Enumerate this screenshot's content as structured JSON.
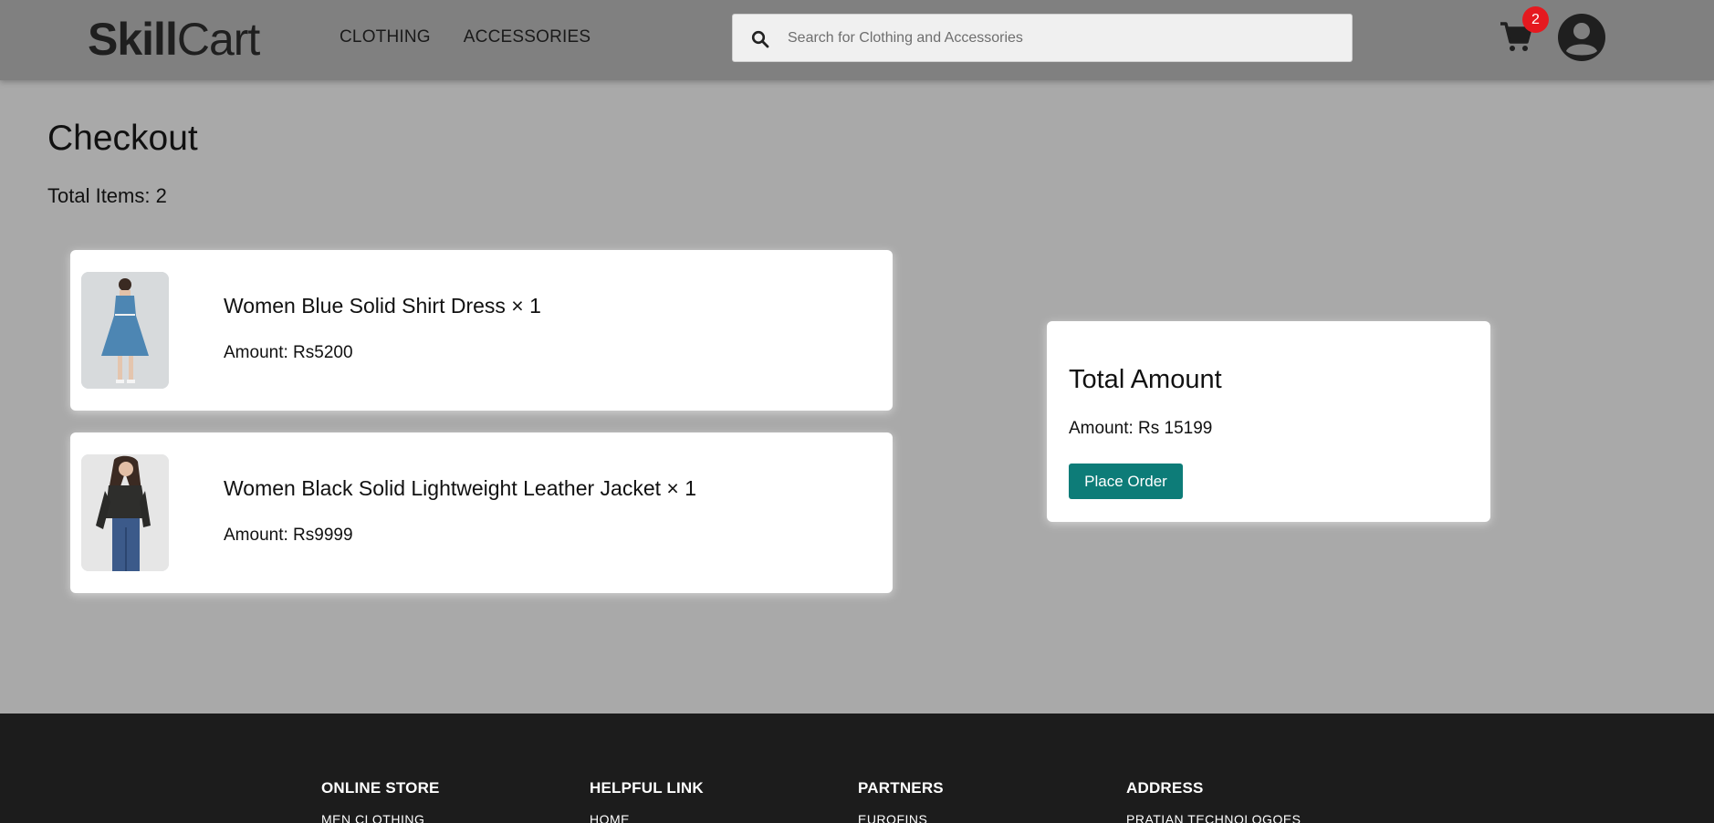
{
  "header": {
    "logo_bold": "Skill",
    "logo_light": "Cart",
    "nav": [
      "CLOTHING",
      "ACCESSORIES"
    ],
    "search_placeholder": "Search for Clothing and Accessories",
    "cart_count": "2"
  },
  "page": {
    "title": "Checkout",
    "total_items": "Total Items: 2"
  },
  "items": [
    {
      "name": "Women Blue Solid Shirt Dress × 1",
      "amount": "Amount: Rs5200",
      "thumb": "blue-dress-photo"
    },
    {
      "name": "Women Black Solid Lightweight Leather Jacket × 1",
      "amount": "Amount: Rs9999",
      "thumb": "leather-jacket-photo"
    }
  ],
  "summary": {
    "title": "Total Amount",
    "amount": "Amount: Rs 15199",
    "place_order": "Place Order"
  },
  "footer": {
    "columns": [
      {
        "heading": "ONLINE STORE",
        "link": "MEN CLOTHING"
      },
      {
        "heading": "HELPFUL LINK",
        "link": "HOME"
      },
      {
        "heading": "PARTNERS",
        "link": "EUROFINS"
      },
      {
        "heading": "ADDRESS",
        "link": "PRATIAN TECHNOLOGOES"
      }
    ]
  },
  "colors": {
    "accent": "#0d7c78",
    "badge": "#e5191f",
    "header": "#808080",
    "background": "#a9a9a9",
    "footer": "#1c1c1c"
  }
}
